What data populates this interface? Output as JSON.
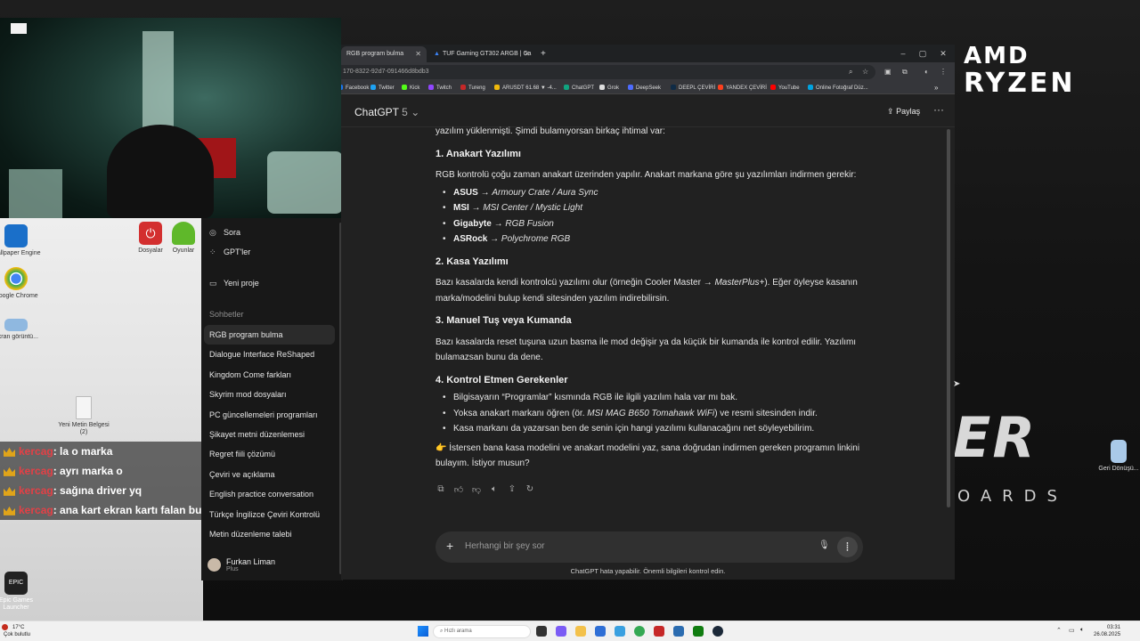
{
  "desktop": {
    "brand_line1": "AMD",
    "brand_line2": "RYZEN",
    "art_text": "ER",
    "art_sub": "OARDS",
    "icons": [
      {
        "label": "Wallpaper Engine",
        "icon": "wallpaper-engine-icon",
        "color": "#1a6fc9"
      },
      {
        "label": "Google Chrome",
        "icon": "chrome-icon",
        "color": "#34a853"
      },
      {
        "label": "Ekran görüntü...",
        "icon": "screenshot-icon",
        "color": "#8fb8e0"
      },
      {
        "label": "Dosyalar",
        "icon": "power-app-icon",
        "color": "#d32f2f"
      },
      {
        "label": "Oyunlar",
        "icon": "tree-icon",
        "color": "#5fb82a"
      },
      {
        "label": "Yeni Metin Belgesi (2)",
        "icon": "text-file-icon",
        "color": "#f5f5f5"
      },
      {
        "label": "Epic Games Launcher",
        "icon": "epic-games-icon",
        "color": "#222222"
      },
      {
        "label": "Geri Dönüşü...",
        "icon": "recycle-bin-icon",
        "color": "#a9c9e8"
      }
    ]
  },
  "stream_chat": [
    {
      "user": "kercag",
      "message": ": la o marka"
    },
    {
      "user": "kercag",
      "message": ": ayrı marka o"
    },
    {
      "user": "kercag",
      "message": ": sağına driver yq"
    },
    {
      "user": "kercag",
      "message": ": ana kart ekran kartı falan bu"
    }
  ],
  "browser": {
    "tabs": [
      {
        "title": "RGB program bulma",
        "active": true
      },
      {
        "title": "TUF Gaming GT302 ARGB | Ca",
        "active": false
      }
    ],
    "new_tab": "+",
    "address": "170-8322-92d7-091466d8bdb3",
    "bookmarks": [
      {
        "label": "Facebook",
        "color": "#1877f2"
      },
      {
        "label": "Twitter",
        "color": "#1da1f2"
      },
      {
        "label": "Kick",
        "color": "#53fc18"
      },
      {
        "label": "Twitch",
        "color": "#9146ff"
      },
      {
        "label": "Tureng",
        "color": "#c62828"
      },
      {
        "label": "ARUSDT 61.68 ▼ -4...",
        "color": "#f0b90b"
      },
      {
        "label": "ChatGPT",
        "color": "#10a37f"
      },
      {
        "label": "Grok",
        "color": "#dddddd"
      },
      {
        "label": "DeepSeek",
        "color": "#4d6bfe"
      },
      {
        "label": "DEEPL ÇEVİRİ",
        "color": "#0f2b46"
      },
      {
        "label": "YANDEX ÇEVİRİ",
        "color": "#fc3f1d"
      },
      {
        "label": "YouTube",
        "color": "#ff0000"
      },
      {
        "label": "Online Fotoğraf Düz...",
        "color": "#00a3e0"
      }
    ]
  },
  "sidebar": {
    "top_items": [
      {
        "label": "Sora",
        "icon": "sora-icon"
      },
      {
        "label": "GPT'ler",
        "icon": "gpts-grid-icon"
      },
      {
        "label": "Yeni proje",
        "icon": "folder-plus-icon"
      }
    ],
    "section_title": "Sohbetler",
    "chats": [
      "RGB program bulma",
      "Dialogue Interface ReShaped",
      "Kingdom Come farkları",
      "Skyrim mod dosyaları",
      "PC güncellemeleri programları",
      "Şikayet metni düzenlemesi",
      "Regret fiili çözümü",
      "Çeviri ve açıklama",
      "English practice conversation",
      "Türkçe İngilizce Çeviri Kontrolü",
      "Metin düzenleme talebi"
    ],
    "active_chat": 0,
    "user": {
      "name": "Furkan Liman",
      "plan": "Plus"
    }
  },
  "chat": {
    "model_name": "ChatGPT",
    "model_version": "5",
    "share_label": "Paylaş",
    "intro": "yazılım yüklenmişti. Şimdi bulamıyorsan birkaç ihtimal var:",
    "section1_title": "1. Anakart Yazılımı",
    "section1_text": "RGB kontrolü çoğu zaman anakart üzerinden yapılır. Anakart markana göre şu yazılımları indirmen gerekir:",
    "section1_items": [
      {
        "brand": "ASUS",
        "software": "Armoury Crate / Aura Sync"
      },
      {
        "brand": "MSI",
        "software": "MSI Center / Mystic Light"
      },
      {
        "brand": "Gigabyte",
        "software": "RGB Fusion"
      },
      {
        "brand": "ASRock",
        "software": "Polychrome RGB"
      }
    ],
    "arrow": " → ",
    "section2_title": "2. Kasa Yazılımı",
    "section2_text_a": "Bazı kasalarda kendi kontrolcü yazılımı olur (örneğin Cooler Master → ",
    "section2_text_italic": "MasterPlus+",
    "section2_text_b": "). Eğer öyleyse kasanın marka/modelini bulup kendi sitesinden yazılım indirebilirsin.",
    "section3_title": "3. Manuel Tuş veya Kumanda",
    "section3_text": "Bazı kasalarda reset tuşuna uzun basma ile mod değişir ya da küçük bir kumanda ile kontrol edilir. Yazılımı bulamazsan bunu da dene.",
    "section4_title": "4. Kontrol Etmen Gerekenler",
    "section4_item1": "Bilgisayarın “Programlar” kısmında RGB ile ilgili yazılım hala var mı bak.",
    "section4_item2_a": "Yoksa anakart markanı öğren (ör. ",
    "section4_item2_italic": "MSI MAG B650 Tomahawk WiFi",
    "section4_item2_b": ") ve resmi sitesinden indir.",
    "section4_item3": "Kasa markanı da yazarsan ben de senin için hangi yazılımı kullanacağını net söyleyebilirim.",
    "closing": "👉 İstersen bana kasa modelini ve anakart modelini yaz, sana doğrudan indirmen gereken programın linkini bulayım. İstiyor musun?",
    "input_placeholder": "Herhangi bir şey sor",
    "disclaimer": "ChatGPT hata yapabilir. Önemli bilgileri kontrol edin."
  },
  "taskbar": {
    "weather_temp": "17°C",
    "weather_desc": "Çok bulutlu",
    "search_placeholder": "Hızlı arama",
    "time": "03:31",
    "date": "26.08.2025",
    "apps": [
      {
        "icon": "task-view-icon",
        "color": "#333333"
      },
      {
        "icon": "copilot-icon",
        "color": "#7b5cf5"
      },
      {
        "icon": "file-explorer-icon",
        "color": "#f3c14b"
      },
      {
        "icon": "store-icon",
        "color": "#2f6fd6"
      },
      {
        "icon": "photos-icon",
        "color": "#3aa0e0"
      },
      {
        "icon": "chrome-icon",
        "color": "#34a853"
      },
      {
        "icon": "app-red-icon",
        "color": "#c62828"
      },
      {
        "icon": "remote-desktop-icon",
        "color": "#2b6cb0"
      },
      {
        "icon": "xbox-icon",
        "color": "#107c10"
      },
      {
        "icon": "steam-icon",
        "color": "#1b2838"
      }
    ]
  }
}
